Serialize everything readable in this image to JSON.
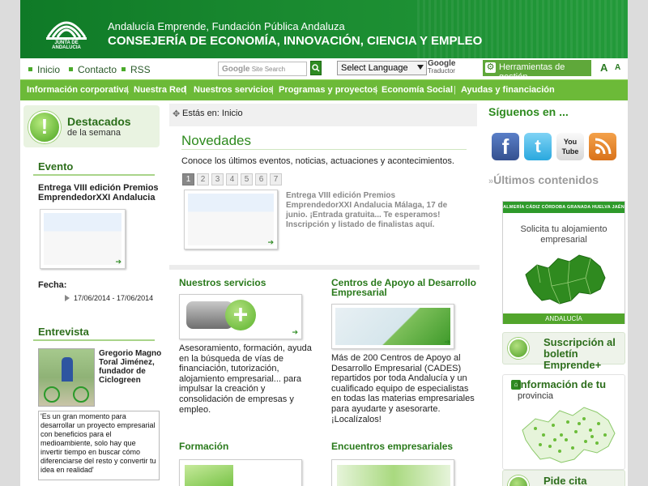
{
  "header": {
    "logo_text": "JUNTA DE ANDALUCIA",
    "line1": "Andalucía Emprende, Fundación Pública Andaluza",
    "line2": "CONSEJERÍA DE ECONOMÍA, INNOVACIÓN, CIENCIA Y EMPLEO"
  },
  "utility": {
    "links": [
      "Inicio",
      "Contacto",
      "RSS"
    ],
    "search_placeholder": "Site Search",
    "search_brand": "Google",
    "language": "Select Language",
    "google_translate_1": "Google",
    "google_translate_2": "Traductor",
    "tools": "Herramientas de gestión",
    "font_large": "A",
    "font_small": "A"
  },
  "nav": [
    "Información corporativa",
    "Nuestra Red",
    "Nuestros servicios",
    "Programas y proyectos",
    "Economía Social",
    "Ayudas y financiación"
  ],
  "left": {
    "destacados_title": "Destacados",
    "destacados_sub": "de la semana",
    "evento_h": "Evento",
    "evento_title": "Entrega VIII edición Premios EmprendedorXXI Andalucia",
    "fecha_label": "Fecha:",
    "fecha_value": "17/06/2014 - 17/06/2014",
    "entrevista_h": "Entrevista",
    "entrevista_name": "Gregorio Magno Toral Jiménez, fundador de Ciclogreen",
    "quote": "'Es un gran momento para desarrollar un proyecto empresarial con beneficios para el medioambiente, solo hay que invertir tiempo en buscar cómo diferenciarse del resto y convertir tu idea en realidad'"
  },
  "center": {
    "breadcrumb_label": "Estás en:",
    "breadcrumb_value": "Inicio",
    "novedades_h": "Novedades",
    "novedades_txt": "Conoce los últimos eventos, noticias, actuaciones y acontecimientos.",
    "pages": [
      "1",
      "2",
      "3",
      "4",
      "5",
      "6",
      "7"
    ],
    "news_item": "Entrega VIII edición Premios EmprendedorXXI Andalucia Málaga, 17 de junio. ¡Entrada gratuita... Te esperamos! Inscripción y listado de finalistas aquí.",
    "servicios_h": "Nuestros servicios",
    "servicios_txt": "Asesoramiento, formación, ayuda en la búsqueda de vías de financiación, tutorización, alojamiento empresarial... para impulsar la creación y consolidación de empresas y empleo.",
    "cades_h": "Centros de Apoyo al Desarrollo Empresarial",
    "cades_txt": "Más de 200 Centros de Apoyo al Desarrollo Empresarial (CADES) repartidos por toda Andalucía y un cualificado equipo de especialistas en todas las materias empresariales para ayudarte y asesorarte. ¡Localízalos!",
    "formacion_h": "Formación",
    "encuentros_h": "Encuentros empresariales"
  },
  "right": {
    "follow_h": "Síguenos en ...",
    "social": [
      "facebook-icon",
      "twitter-icon",
      "youtube-icon",
      "rss-feed-icon"
    ],
    "youtube_label": "You Tube",
    "ultimos": "Últimos contenidos",
    "provinces": "ALMERÍA CÁDIZ CÓRDOBA GRANADA HUELVA JAÉN MÁLAGA SEVILLA",
    "alojamiento": "Solicita tu alojamiento empresarial",
    "andalucia": "ANDALUCÍA",
    "suscripcion": "Suscripción al boletín Emprende+",
    "info_title": "Información de tu",
    "info_sub": "provincia",
    "cita": "Pide cita"
  },
  "colors": {
    "brand_green": "#1a8a30",
    "nav_green": "#6cba38",
    "heading_green": "#2d8a1e"
  }
}
